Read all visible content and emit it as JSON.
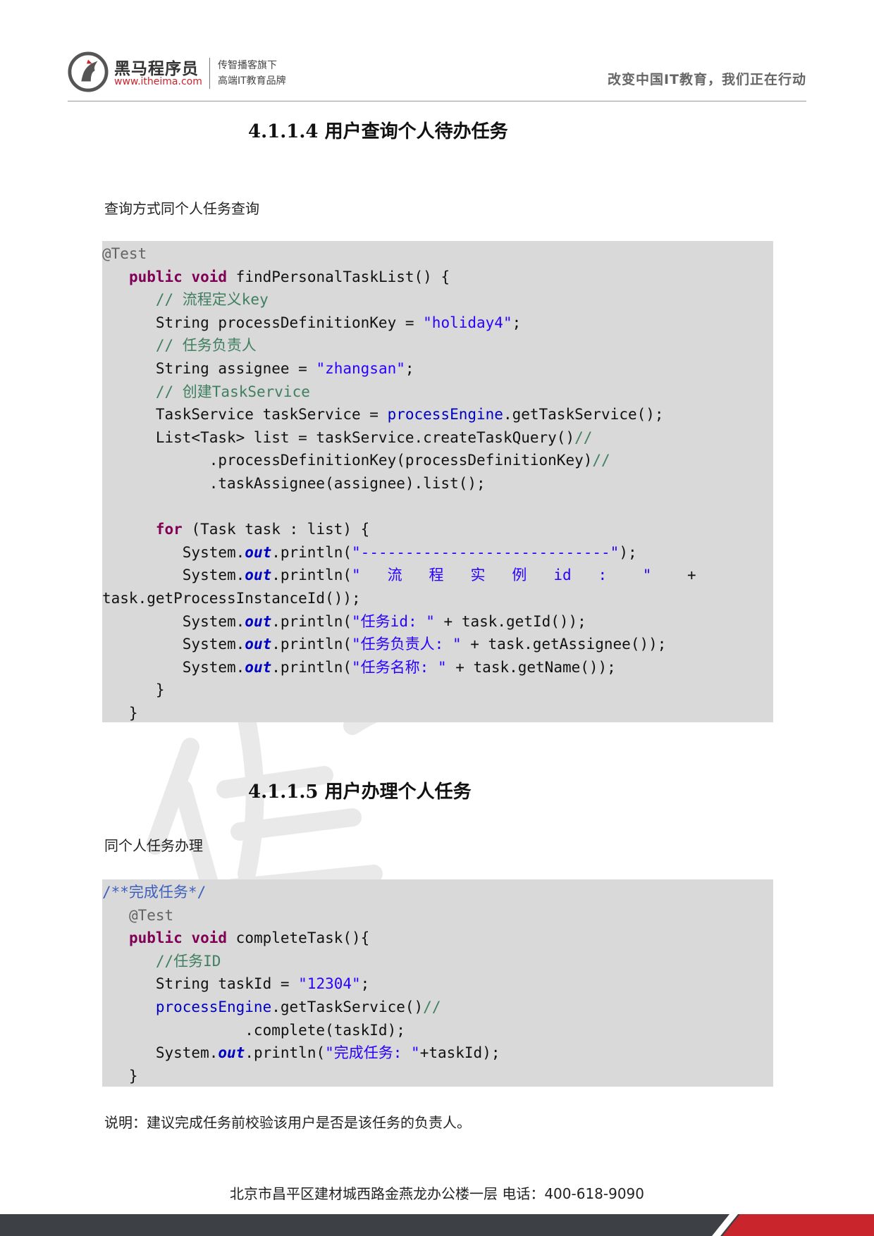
{
  "header": {
    "logo_name": "黑马程序员",
    "logo_url": "www.itheima.com",
    "tagline_1": "传智播客旗下",
    "tagline_2": "高端IT教育品牌",
    "slogan": "改变中国IT教育，我们正在行动"
  },
  "section1": {
    "heading": "4.1.1.4 用户查询个人待办任务",
    "intro": "查询方式同个人任务查询"
  },
  "code1": [
    [
      [
        "an",
        "@Test"
      ]
    ],
    [
      [
        "",
        "   "
      ],
      [
        "kw",
        "public"
      ],
      [
        "",
        " "
      ],
      [
        "kw",
        "void"
      ],
      [
        "",
        " findPersonalTaskList() {"
      ]
    ],
    [
      [
        "",
        "      "
      ],
      [
        "cm",
        "// 流程定义key"
      ]
    ],
    [
      [
        "",
        "      String processDefinitionKey = "
      ],
      [
        "st",
        "\"holiday4\""
      ],
      [
        "",
        ";"
      ]
    ],
    [
      [
        "",
        "      "
      ],
      [
        "cm",
        "// 任务负责人"
      ]
    ],
    [
      [
        "",
        "      String assignee = "
      ],
      [
        "st",
        "\"zhangsan\""
      ],
      [
        "",
        ";"
      ]
    ],
    [
      [
        "",
        "      "
      ],
      [
        "cm",
        "// 创建TaskService"
      ]
    ],
    [
      [
        "",
        "      TaskService taskService = "
      ],
      [
        "fd",
        "processEngine"
      ],
      [
        "",
        ".getTaskService();"
      ]
    ],
    [
      [
        "",
        "      List<Task> list = taskService.createTaskQuery()"
      ],
      [
        "cm",
        "//"
      ]
    ],
    [
      [
        "",
        "            .processDefinitionKey(processDefinitionKey)"
      ],
      [
        "cm",
        "//"
      ]
    ],
    [
      [
        "",
        "            .taskAssignee(assignee).list();"
      ]
    ],
    [
      [
        "",
        ""
      ]
    ],
    [
      [
        "",
        "      "
      ],
      [
        "kw",
        "for"
      ],
      [
        "",
        " (Task task : list) {"
      ]
    ],
    [
      [
        "",
        "         System."
      ],
      [
        "it",
        "out"
      ],
      [
        "",
        ".println("
      ],
      [
        "st",
        "\"----------------------------\""
      ],
      [
        "",
        ");"
      ]
    ],
    [
      [
        "",
        "         System."
      ],
      [
        "it",
        "out"
      ],
      [
        "",
        ".println("
      ],
      [
        "st",
        "\"   流   程   实   例   id   :    \""
      ],
      [
        "",
        "    +"
      ]
    ],
    [
      [
        "",
        "task.getProcessInstanceId());"
      ]
    ],
    [
      [
        "",
        "         System."
      ],
      [
        "it",
        "out"
      ],
      [
        "",
        ".println("
      ],
      [
        "st",
        "\"任务id: \""
      ],
      [
        "",
        " + task.getId());"
      ]
    ],
    [
      [
        "",
        "         System."
      ],
      [
        "it",
        "out"
      ],
      [
        "",
        ".println("
      ],
      [
        "st",
        "\"任务负责人: \""
      ],
      [
        "",
        " + task.getAssignee());"
      ]
    ],
    [
      [
        "",
        "         System."
      ],
      [
        "it",
        "out"
      ],
      [
        "",
        ".println("
      ],
      [
        "st",
        "\"任务名称: \""
      ],
      [
        "",
        " + task.getName());"
      ]
    ],
    [
      [
        "",
        "      }"
      ]
    ],
    [
      [
        "",
        "   }"
      ]
    ]
  ],
  "section2": {
    "heading": "4.1.1.5 用户办理个人任务",
    "intro": "同个人任务办理"
  },
  "code2": [
    [
      [
        "jd",
        "/**完成任务*/"
      ]
    ],
    [
      [
        "",
        "   "
      ],
      [
        "an",
        "@Test"
      ]
    ],
    [
      [
        "",
        "   "
      ],
      [
        "kw",
        "public"
      ],
      [
        "",
        " "
      ],
      [
        "kw",
        "void"
      ],
      [
        "",
        " completeTask(){"
      ]
    ],
    [
      [
        "",
        "      "
      ],
      [
        "cm",
        "//任务ID"
      ]
    ],
    [
      [
        "",
        "      String taskId = "
      ],
      [
        "st",
        "\"12304\""
      ],
      [
        "",
        ";"
      ]
    ],
    [
      [
        "",
        "      "
      ],
      [
        "fd",
        "processEngine"
      ],
      [
        "",
        ".getTaskService()"
      ],
      [
        "cm",
        "//"
      ]
    ],
    [
      [
        "",
        "                .complete(taskId);"
      ]
    ],
    [
      [
        "",
        "      System."
      ],
      [
        "it",
        "out"
      ],
      [
        "",
        ".println("
      ],
      [
        "st",
        "\"完成任务: \""
      ],
      [
        "",
        "+taskId);"
      ]
    ],
    [
      [
        "",
        "   }"
      ]
    ]
  ],
  "note": "说明：建议完成任务前校验该用户是否是该任务的负责人。",
  "footer": {
    "address": "北京市昌平区建材城西路金燕龙办公楼一层      电话：400-618-9090"
  },
  "colors": {
    "code_bg": "#d9d9d9",
    "keyword": "#7f0055",
    "comment": "#3f7f5f",
    "string": "#2a00ff",
    "brand_red": "#c9252c",
    "footer_bar": "#3d4145"
  }
}
